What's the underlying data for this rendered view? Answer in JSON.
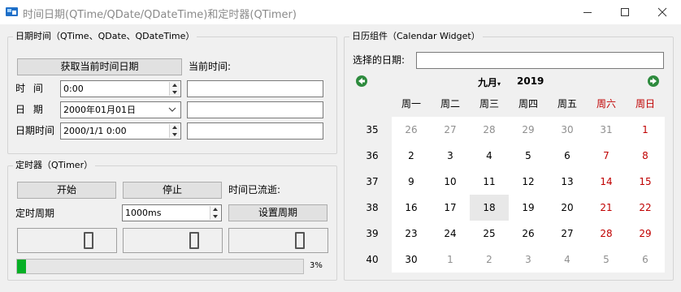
{
  "window": {
    "title": "时间日期(QTime/QDate/QDateTime)和定时器(QTimer)"
  },
  "datetime_group": {
    "title": "日期时间（QTime、QDate、QDateTime）",
    "get_button": "获取当前时间日期",
    "current_label": "当前时间:",
    "time_label": "时  间",
    "time_value": "0:00",
    "date_label": "日  期",
    "date_value": "2000年01月01日",
    "datetime_label": "日期时间",
    "datetime_value": "2000/1/1 0:00",
    "time_result": "",
    "date_result": "",
    "datetime_result": ""
  },
  "timer_group": {
    "title": "定时器（QTimer）",
    "start_button": "开始",
    "stop_button": "停止",
    "elapsed_label": "时间已流逝:",
    "period_label": "定时周期",
    "period_value": "1000ms",
    "set_period_button": "设置周期",
    "lcd_values": [
      "0",
      "0",
      "0"
    ],
    "progress_percent": 3,
    "progress_text": "3%"
  },
  "calendar_group": {
    "title": "日历组件（Calendar Widget）",
    "selected_label": "选择的日期:",
    "selected_value": "",
    "month": "九月",
    "year": "2019",
    "weekdays": [
      "周一",
      "周二",
      "周三",
      "周四",
      "周五",
      "周六",
      "周日"
    ],
    "weeks": [
      {
        "num": "35",
        "days": [
          "26",
          "27",
          "28",
          "29",
          "30",
          "31",
          "1"
        ]
      },
      {
        "num": "36",
        "days": [
          "2",
          "3",
          "4",
          "5",
          "6",
          "7",
          "8"
        ]
      },
      {
        "num": "37",
        "days": [
          "9",
          "10",
          "11",
          "12",
          "13",
          "14",
          "15"
        ]
      },
      {
        "num": "38",
        "days": [
          "16",
          "17",
          "18",
          "19",
          "20",
          "21",
          "22"
        ]
      },
      {
        "num": "39",
        "days": [
          "23",
          "24",
          "25",
          "26",
          "27",
          "28",
          "29"
        ]
      },
      {
        "num": "40",
        "days": [
          "30",
          "1",
          "2",
          "3",
          "4",
          "5",
          "6"
        ]
      }
    ],
    "selected_day": "18",
    "colors": {
      "weekend": "#c00000",
      "other_month": "#8f8f8f",
      "nav": "#2e8b3e"
    }
  }
}
